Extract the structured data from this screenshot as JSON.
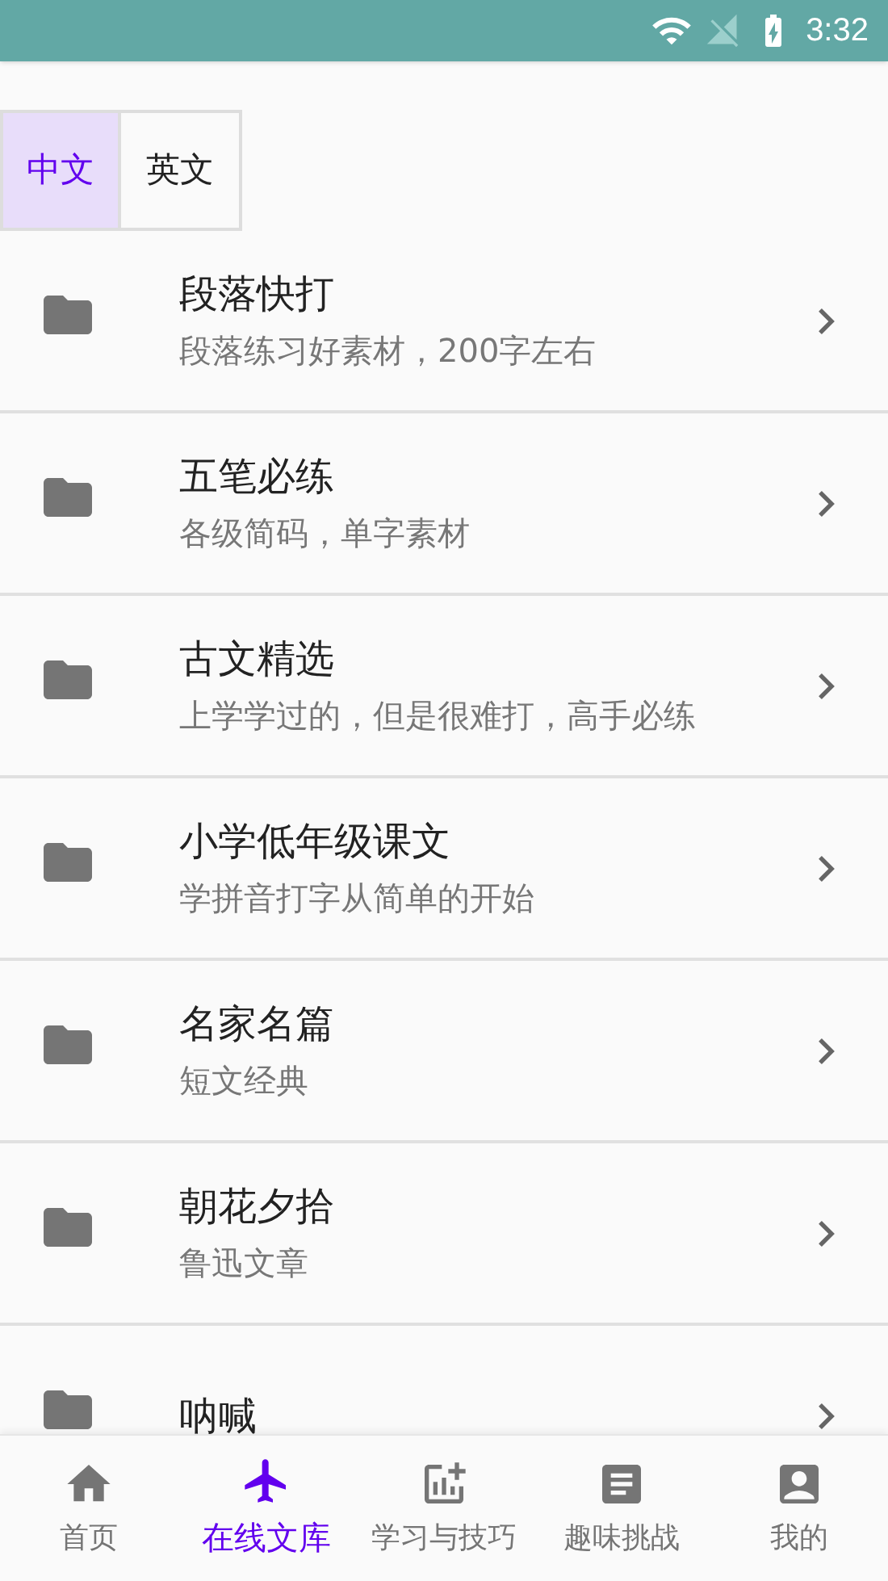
{
  "status_bar": {
    "time": "3:32"
  },
  "tabs": [
    {
      "label": "中文",
      "selected": true
    },
    {
      "label": "英文",
      "selected": false
    }
  ],
  "items": [
    {
      "title": "段落快打",
      "subtitle": "段落练习好素材，200字左右"
    },
    {
      "title": "五笔必练",
      "subtitle": "各级简码，单字素材"
    },
    {
      "title": "古文精选",
      "subtitle": "上学学过的，但是很难打，高手必练"
    },
    {
      "title": "小学低年级课文",
      "subtitle": "学拼音打字从简单的开始"
    },
    {
      "title": "名家名篇",
      "subtitle": "短文经典"
    },
    {
      "title": "朝花夕拾",
      "subtitle": "鲁迅文章"
    },
    {
      "title": "呐喊"
    }
  ],
  "bottom_nav": [
    {
      "label": "首页",
      "selected": false
    },
    {
      "label": "在线文库",
      "selected": true
    },
    {
      "label": "学习与技巧",
      "selected": false
    },
    {
      "label": "趣味挑战",
      "selected": false
    },
    {
      "label": "我的",
      "selected": false
    }
  ]
}
